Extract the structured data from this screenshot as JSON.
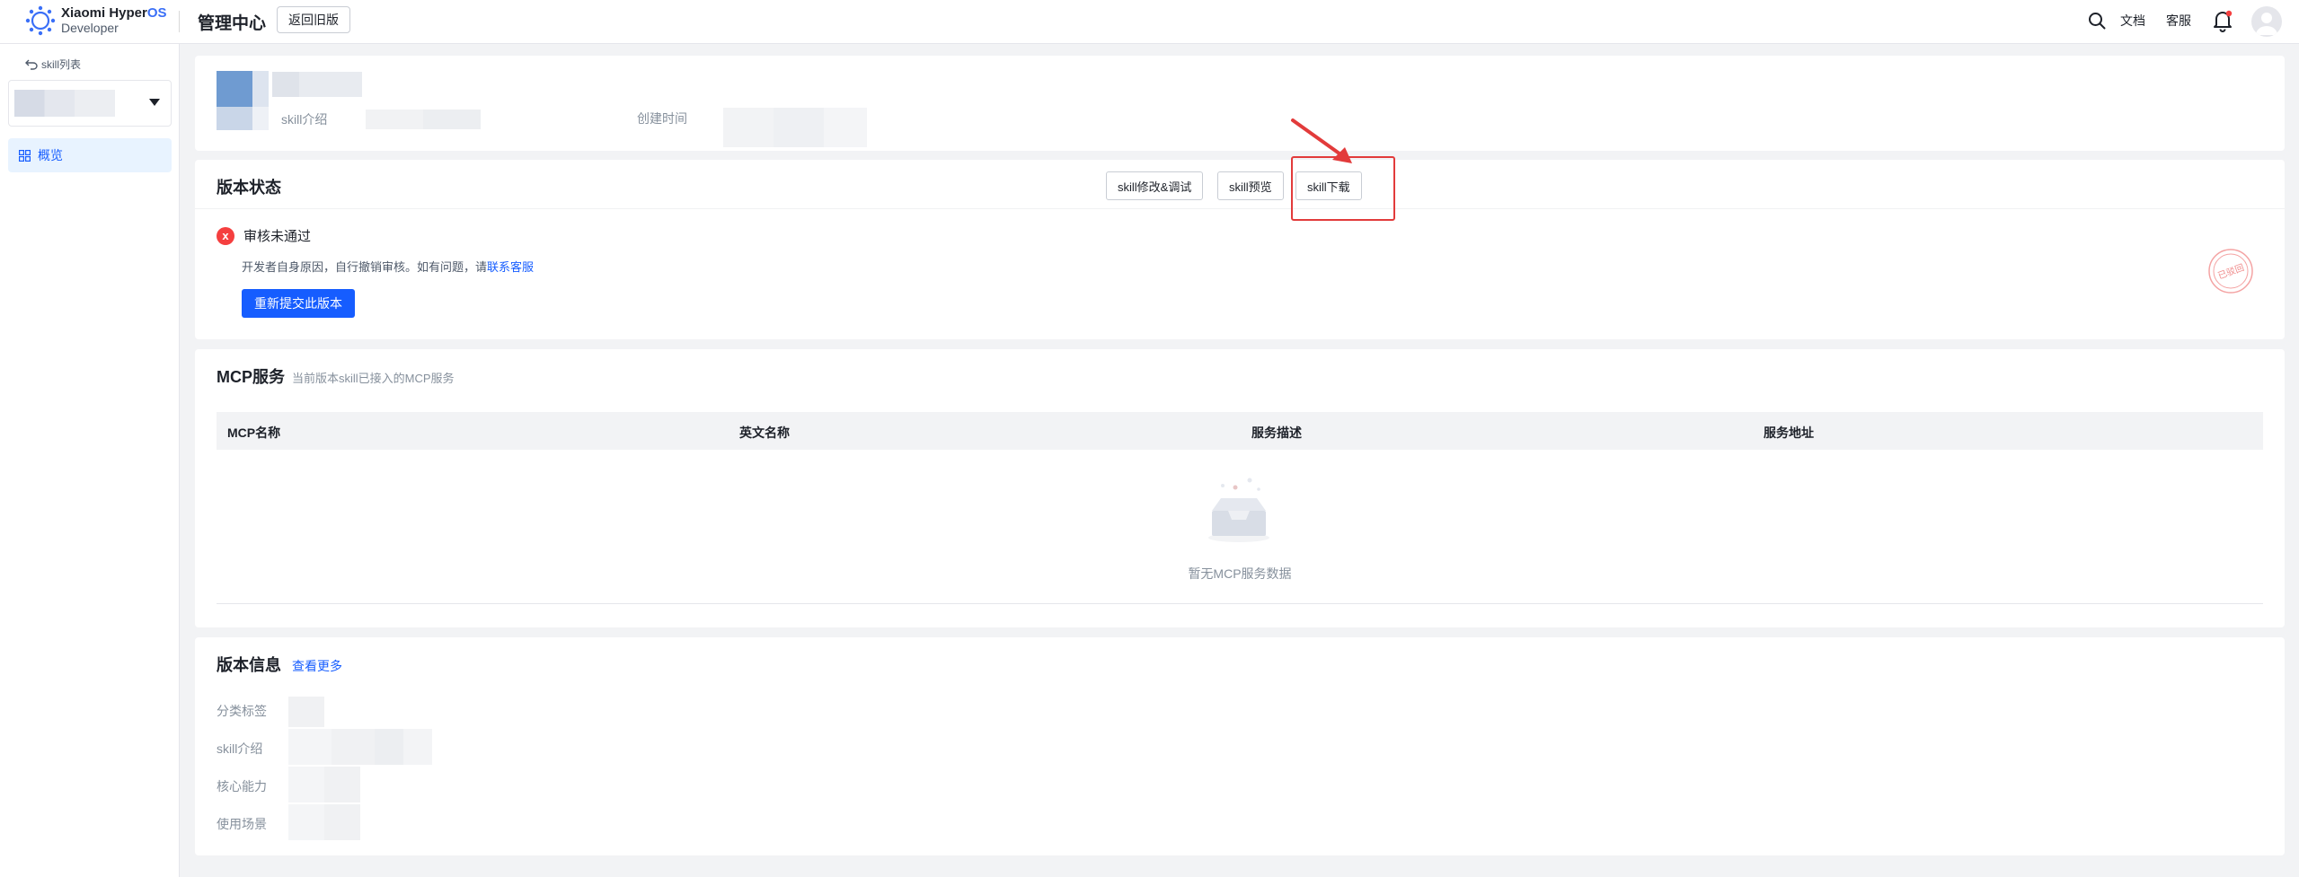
{
  "header": {
    "logo_line1": "Xiaomi Hyper",
    "logo_line1_os": "OS",
    "logo_line2": "Developer",
    "title": "管理中心",
    "back_old_label": "返回旧版",
    "docs_label": "文档",
    "service_label": "客服"
  },
  "sidebar": {
    "back_label": "skill列表",
    "nav_overview": "概览"
  },
  "overview": {
    "intro_label": "skill介绍",
    "created_label": "创建时间"
  },
  "version_status": {
    "title": "版本状态",
    "buttons": {
      "edit": "skill修改&调试",
      "preview": "skill预览",
      "download": "skill下载"
    },
    "status_icon": "x",
    "status_text": "审核未通过",
    "desc_prefix": "开发者自身原因，自行撤销审核。如有问题，请",
    "desc_link": "联系客服",
    "resubmit_label": "重新提交此版本",
    "stamp_text": "已驳回"
  },
  "mcp": {
    "title": "MCP服务",
    "subtitle": "当前版本skill已接入的MCP服务",
    "columns": [
      "MCP名称",
      "英文名称",
      "服务描述",
      "服务地址"
    ],
    "empty_text": "暂无MCP服务数据"
  },
  "version_info": {
    "title": "版本信息",
    "more_label": "查看更多",
    "rows": [
      "分类标签",
      "skill介绍",
      "核心能力",
      "使用场景"
    ]
  },
  "colors": {
    "primary": "#165dff",
    "error": "#f53f3f",
    "highlight": "#e23b3b"
  }
}
